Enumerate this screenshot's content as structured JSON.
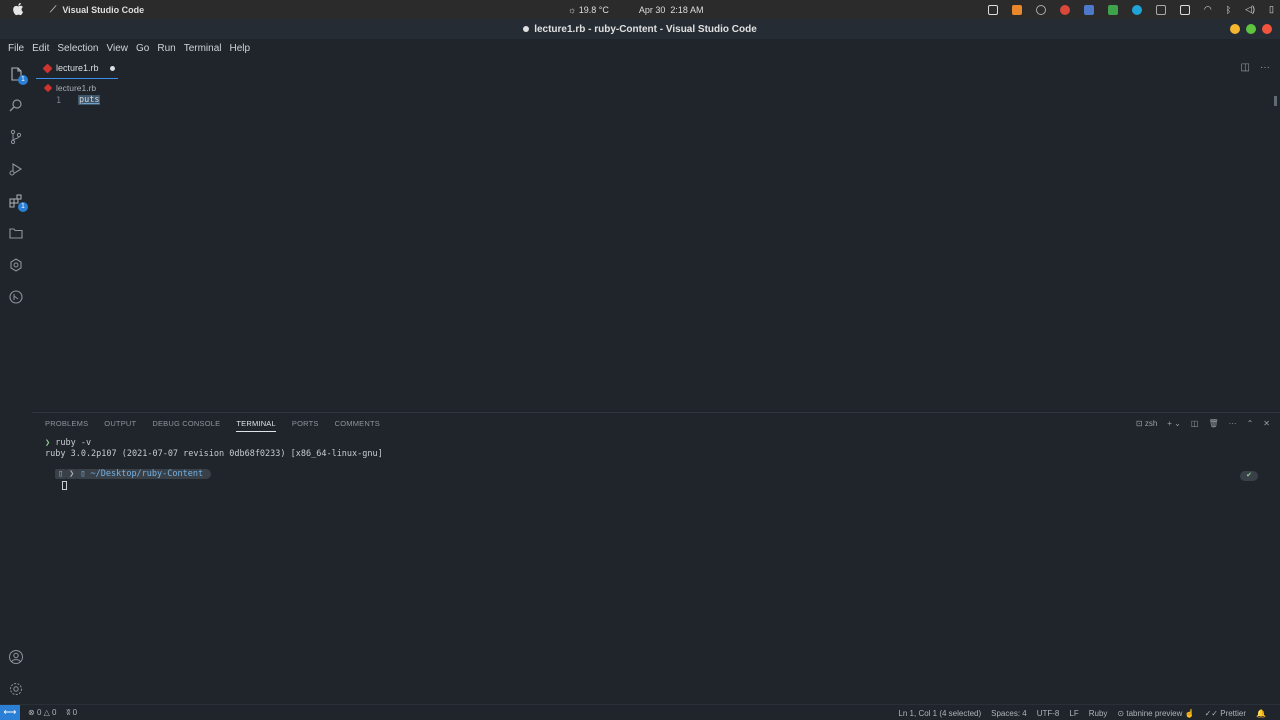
{
  "os": {
    "app_name": "Visual Studio Code",
    "temperature": "19.8 °C",
    "date": "Apr 30",
    "time": "2:18 AM"
  },
  "window": {
    "title": "lecture1.rb - ruby-Content - Visual Studio Code"
  },
  "menu": [
    "File",
    "Edit",
    "Selection",
    "View",
    "Go",
    "Run",
    "Terminal",
    "Help"
  ],
  "activity": {
    "explorer_badge": "1",
    "extensions_badge": "1"
  },
  "tab": {
    "filename": "lecture1.rb"
  },
  "breadcrumb": {
    "file": "lecture1.rb"
  },
  "editor": {
    "line_number": "1",
    "code": "puts"
  },
  "panel": {
    "tabs": [
      "PROBLEMS",
      "OUTPUT",
      "DEBUG CONSOLE",
      "TERMINAL",
      "PORTS",
      "COMMENTS"
    ],
    "active_tab": "TERMINAL",
    "shell": "zsh"
  },
  "terminal": {
    "command": "ruby -v",
    "output": "ruby 3.0.2p107 (2021-07-07 revision 0db68f0233) [x86_64-linux-gnu]",
    "path_prefix": "~/Desktop/",
    "path_dir": "ruby-Content",
    "check": "✔"
  },
  "status": {
    "errors": "0",
    "warnings": "0",
    "ports": "0",
    "cursor": "Ln 1, Col 1 (4 selected)",
    "spaces": "Spaces: 4",
    "encoding": "UTF-8",
    "eol": "LF",
    "language": "Ruby",
    "tabnine": "tabnine preview",
    "prettier": "Prettier"
  },
  "colors": {
    "accent": "#2b7fd4",
    "background": "#1f252b",
    "ruby": "#cc342d"
  }
}
